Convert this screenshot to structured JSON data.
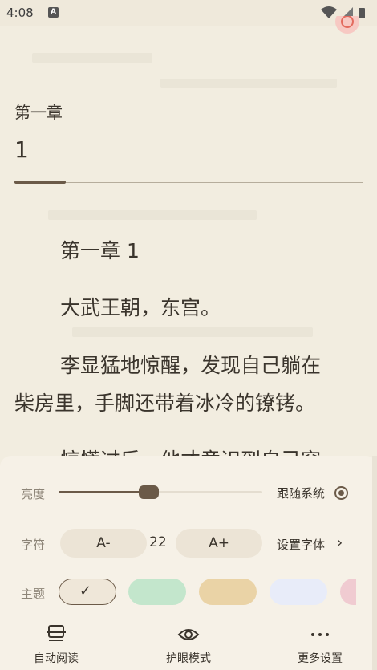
{
  "status": {
    "time": "4:08",
    "a_badge": "A"
  },
  "chapter": {
    "label": "第一章",
    "number": "1"
  },
  "content": {
    "title": "第一章 1",
    "p1": "大武王朝，东宫。",
    "p2a": "李显猛地惊醒，发现自己躺在",
    "p2b": "柴房里，手脚还带着冰冷的镣铐。",
    "p3": "惊慌过后，他才意识到自己穿"
  },
  "settings": {
    "brightness_label": "亮度",
    "brightness_value": 0.44,
    "follow_system_label": "跟随系统",
    "font_label": "字符",
    "font_decrease": "A-",
    "font_size": "22",
    "font_increase": "A+",
    "set_font_label": "设置字体",
    "theme_label": "主题",
    "themes": [
      "#efe7d9",
      "#c3e6cc",
      "#ead3a6",
      "#e8ecf9",
      "#f0cbd1"
    ]
  },
  "bottom_bar": {
    "auto_read": "自动阅读",
    "eye_mode": "护眼模式",
    "more_settings": "更多设置"
  }
}
